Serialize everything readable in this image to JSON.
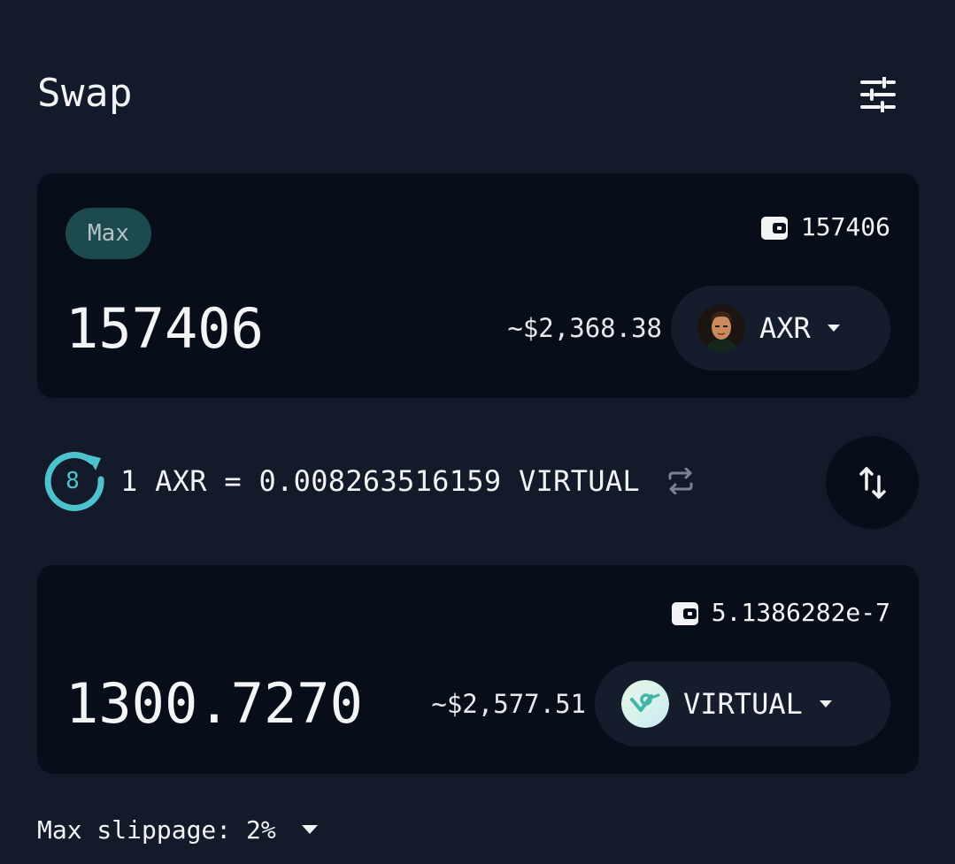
{
  "header": {
    "title": "Swap",
    "settings_icon": "sliders-icon"
  },
  "from": {
    "max_label": "Max",
    "balance": "157406",
    "amount": "157406",
    "usd_value": "~$2,368.38",
    "token": {
      "symbol": "AXR",
      "logo": "axr-avatar-icon"
    }
  },
  "rate": {
    "refresh_seconds": "8",
    "text": "1 AXR = 0.008263516159 VIRTUAL",
    "invert_icon": "swap-arrows-icon"
  },
  "flip_icon": "up-down-arrows-icon",
  "to": {
    "balance": "5.1386282e-7",
    "amount": "1300.7270",
    "usd_value": "~$2,577.51",
    "token": {
      "symbol": "VIRTUAL",
      "logo": "virtual-logo-icon"
    }
  },
  "slippage": {
    "label": "Max slippage: 2%"
  },
  "colors": {
    "background": "#131a2a",
    "panel": "#080d1a",
    "token_button": "#151c2c",
    "max_pill": "#1d4a4f",
    "accent_teal": "#4cc3cc",
    "text": "#f2f3f5"
  }
}
